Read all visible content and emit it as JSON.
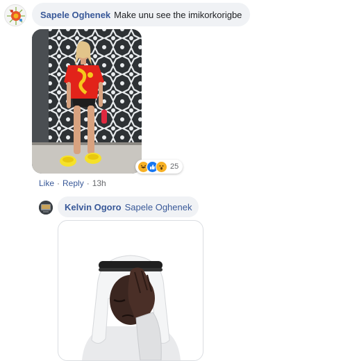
{
  "comment": {
    "author": "Sapele Oghenek",
    "text": "Make unu see the imikorkorigbe",
    "avatar_icon": "avatar-icon",
    "reactions": {
      "icons": [
        "haha-reaction-icon",
        "like-reaction-icon",
        "wow-reaction-icon"
      ],
      "count": "25"
    },
    "actions": {
      "like": "Like",
      "reply": "Reply",
      "time": "13h",
      "separator": "·"
    }
  },
  "reply": {
    "author": "Kelvin Ogoro",
    "mention": "Sapele Oghenek",
    "avatar_icon": "avatar-icon",
    "sticker_icon": "facepalm-sticker-icon"
  },
  "colors": {
    "link": "#385898",
    "bubble": "#f0f2f5",
    "meta": "#65676b"
  }
}
